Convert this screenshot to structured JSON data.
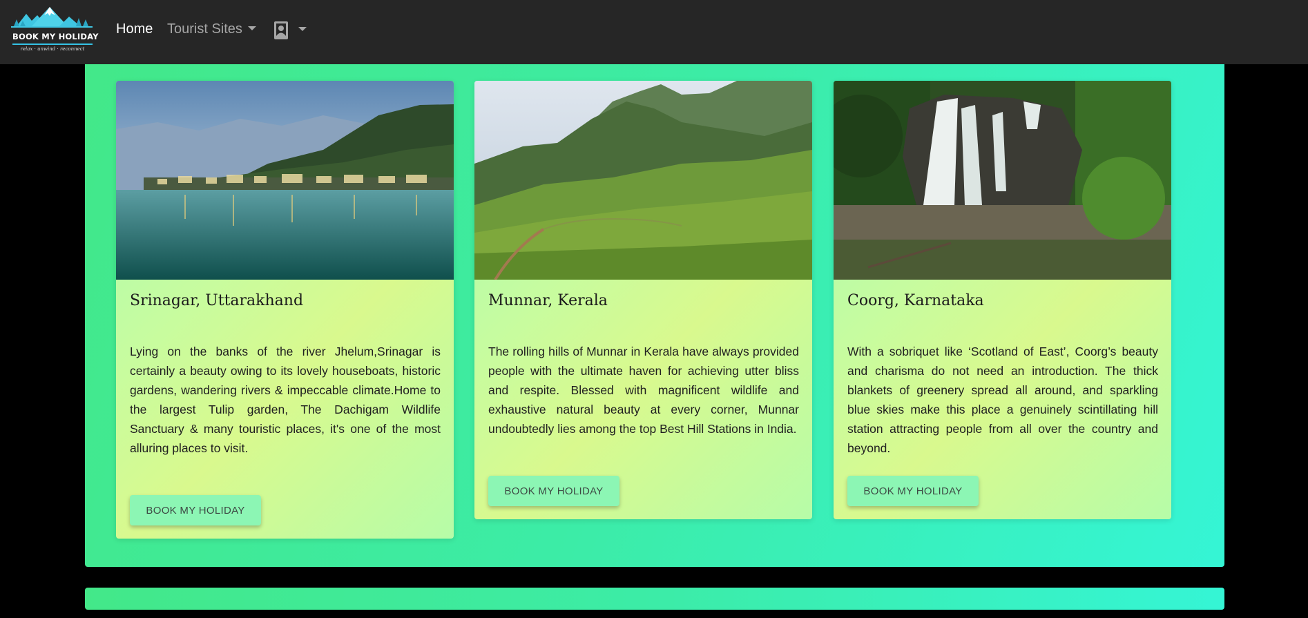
{
  "navbar": {
    "brand_text": "BOOK MY HOLIDAY",
    "brand_tagline": "relax · unwind · reconnect",
    "home_label": "Home",
    "sites_label": "Tourist Sites",
    "user_icon": "user-portrait-icon"
  },
  "cards": [
    {
      "title": "Srinagar, Uttarakhand",
      "text": "Lying on the banks of the river Jhelum,Srinagar is certainly a beauty owing to its lovely houseboats, historic gardens, wandering rivers & impeccable climate.Home to the largest Tulip garden, The Dachigam Wildlife Sanctuary & many touristic places, it's one of the most alluring places to visit.",
      "button": "BOOK MY HOLIDAY"
    },
    {
      "title": "Munnar, Kerala",
      "text": "The rolling hills of Munnar in Kerala have always provided people with the ultimate haven for achieving utter bliss and respite. Blessed with magnificent wildlife and exhaustive natural beauty at every corner, Munnar undoubtedly lies among the top Best Hill Stations in India.",
      "button": "BOOK MY HOLIDAY"
    },
    {
      "title": "Coorg, Karnataka",
      "text": "With a sobriquet like ‘Scotland of East’, Coorg’s beauty and charisma do not need an introduction. The thick blankets of greenery spread all around, and sparkling blue skies make this place a genuinely scintillating hill station attracting people from all over the country and beyond.",
      "button": "BOOK MY HOLIDAY"
    }
  ],
  "colors": {
    "navbar_bg": "#262626",
    "panel_gradient_start": "#43e889",
    "panel_gradient_end": "#35f5d5",
    "button_bg": "#8cf6b4"
  }
}
